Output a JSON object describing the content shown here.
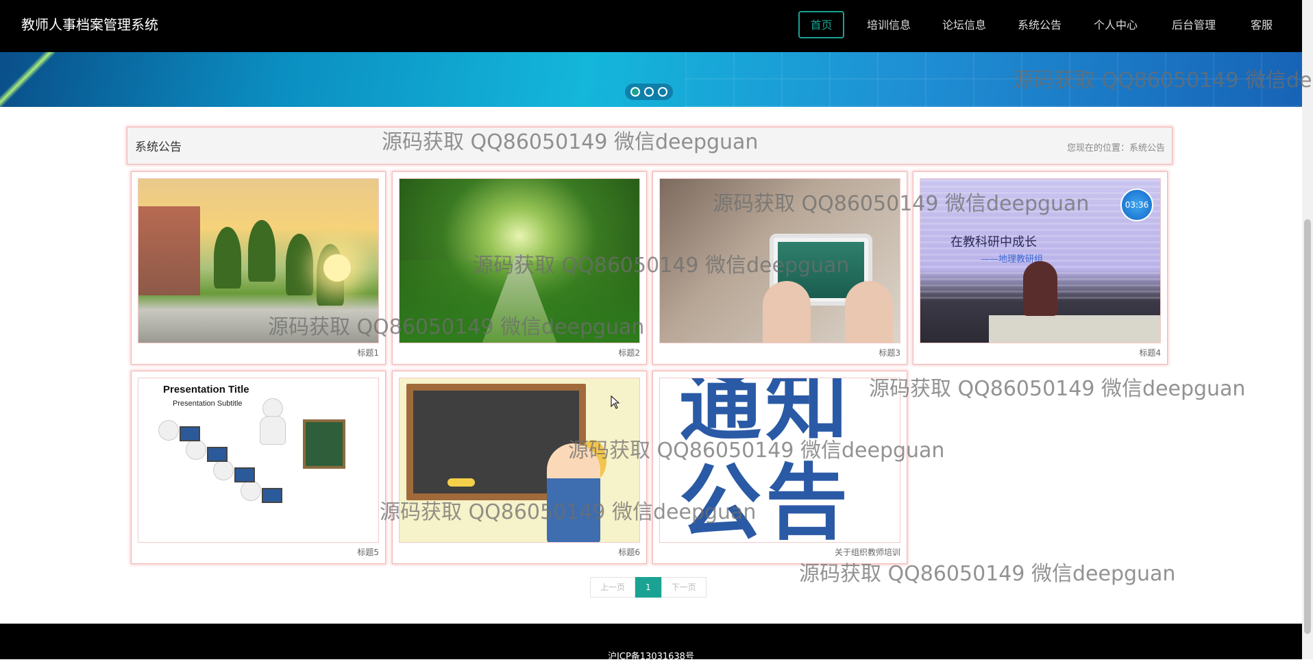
{
  "navbar": {
    "brand": "教师人事档案管理系统",
    "items": [
      {
        "label": "首页",
        "active": true
      },
      {
        "label": "培训信息",
        "active": false
      },
      {
        "label": "论坛信息",
        "active": false
      },
      {
        "label": "系统公告",
        "active": false
      },
      {
        "label": "个人中心",
        "active": false
      },
      {
        "label": "后台管理",
        "active": false
      },
      {
        "label": "客服",
        "active": false
      }
    ]
  },
  "carousel": {
    "slide_count": 3,
    "active_index": 0
  },
  "section": {
    "title": "系统公告",
    "breadcrumb": "您现在的位置：系统公告"
  },
  "cards": [
    {
      "caption": "标题1",
      "image": "campus-sunset"
    },
    {
      "caption": "标题2",
      "image": "tree-lined-road"
    },
    {
      "caption": "标题3",
      "image": "tablet-online-class"
    },
    {
      "caption": "标题4",
      "image": "meeting-presentation",
      "image_text": "在教科研中成长",
      "image_subtext": "——地理教研组",
      "badge": "03:36"
    },
    {
      "caption": "标题5",
      "image": "classroom-figures",
      "image_text": "Presentation Title",
      "image_subtext": "Presentation Subtitle"
    },
    {
      "caption": "标题6",
      "image": "cartoon-teacher-blackboard"
    },
    {
      "caption": "关于组织教师培训",
      "image": "notice-poster",
      "image_text": "通知",
      "image_subtext": "公告"
    }
  ],
  "pagination": {
    "prev": "上一页",
    "current": "1",
    "next": "下一页"
  },
  "footer": {
    "icp": "沪ICP备13031638号"
  },
  "watermark": "源码获取 QQ86050149 微信deepguan",
  "colors": {
    "accent": "#1aa393",
    "navbar_bg": "#000000",
    "card_border": "#f2b8b8"
  }
}
